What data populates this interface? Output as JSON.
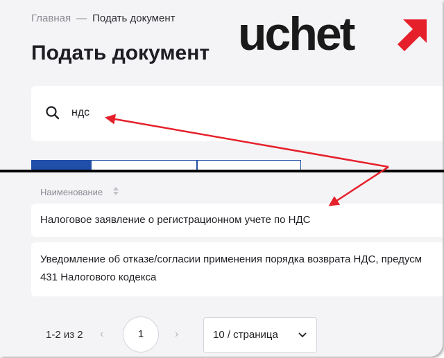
{
  "breadcrumb": {
    "home": "Главная",
    "separator": "—",
    "current": "Подать документ"
  },
  "page_title": "Подать документ",
  "logo": {
    "text": "uchet",
    "accent_color": "#e5202a"
  },
  "search": {
    "value": "ндс",
    "icon": "search-icon"
  },
  "table": {
    "column_header": "Наименование",
    "rows": [
      "Налоговое заявление о регистрационном учете по НДС",
      "Уведомление об отказе/согласии применения порядка возврата НДС, предусм\n431 Налогового кодекса"
    ]
  },
  "pagination": {
    "range": "1-2 из 2",
    "prev": "‹",
    "next": "›",
    "current_page": "1",
    "page_size": "10 / страница"
  },
  "colors": {
    "annotation_red": "#e5202a",
    "tab_blue": "#1f4fa8"
  }
}
